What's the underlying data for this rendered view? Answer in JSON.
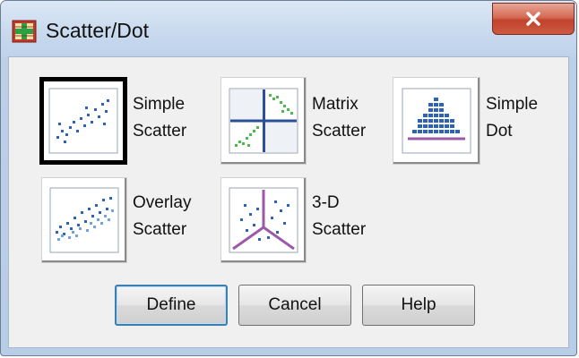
{
  "window": {
    "title": "Scatter/Dot"
  },
  "chart_types": [
    {
      "line1": "Simple",
      "line2": "Scatter"
    },
    {
      "line1": "Matrix",
      "line2": "Scatter"
    },
    {
      "line1": "Simple",
      "line2": "Dot"
    },
    {
      "line1": "Overlay",
      "line2": "Scatter"
    },
    {
      "line1": "3-D",
      "line2": "Scatter"
    }
  ],
  "selected_chart": "Simple Scatter",
  "buttons": {
    "define": "Define",
    "cancel": "Cancel",
    "help": "Help"
  },
  "icons": {
    "app": "spss-chart-icon",
    "close": "close-icon"
  },
  "colors": {
    "accent": "#2d62b8",
    "axis": "#2b4f9a",
    "purple": "#9b5aa8",
    "green": "#4db84d",
    "close_red": "#c2432b"
  }
}
